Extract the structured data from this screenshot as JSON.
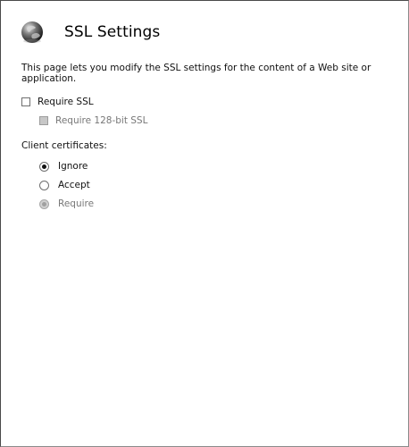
{
  "page": {
    "title": "SSL Settings",
    "description": "This page lets you modify the SSL settings for the content of a Web site or application.",
    "icon": "globe-icon"
  },
  "ssl": {
    "require_ssl": {
      "label": "Require SSL",
      "checked": false,
      "enabled": true
    },
    "require_128": {
      "label": "Require 128-bit SSL",
      "checked": false,
      "enabled": false
    }
  },
  "client_certificates": {
    "label": "Client certificates:",
    "options": [
      {
        "label": "Ignore",
        "selected": true,
        "enabled": true
      },
      {
        "label": "Accept",
        "selected": false,
        "enabled": true
      },
      {
        "label": "Require",
        "selected": false,
        "enabled": false
      }
    ]
  }
}
